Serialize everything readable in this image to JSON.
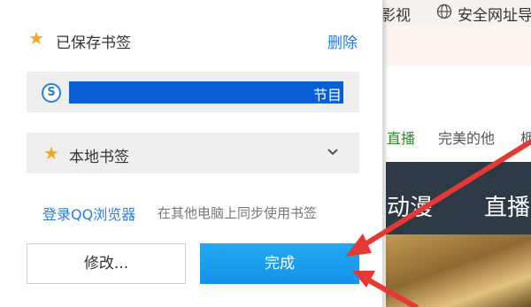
{
  "background_page": {
    "top_links": {
      "video": "影视",
      "safe_site": "安全网址导"
    },
    "nav": {
      "live": "直播",
      "perfect": "完美的他",
      "more": "枥"
    },
    "dark_nav": {
      "anime": "动漫",
      "live": "直播"
    }
  },
  "popup": {
    "header": {
      "title": "已保存书签",
      "delete_label": "删除"
    },
    "name_field": {
      "value": "节目"
    },
    "folder": {
      "selected": "本地书签"
    },
    "sync": {
      "login_link": "登录QQ浏览器",
      "description": "在其他电脑上同步使用书签"
    },
    "buttons": {
      "edit": "修改...",
      "done": "完成"
    }
  },
  "colors": {
    "accent_blue": "#2a7de1",
    "star": "#f5a623",
    "done_button": "#1a9cee",
    "selection": "#0a5fd6",
    "annotation_arrow": "#e53935"
  }
}
